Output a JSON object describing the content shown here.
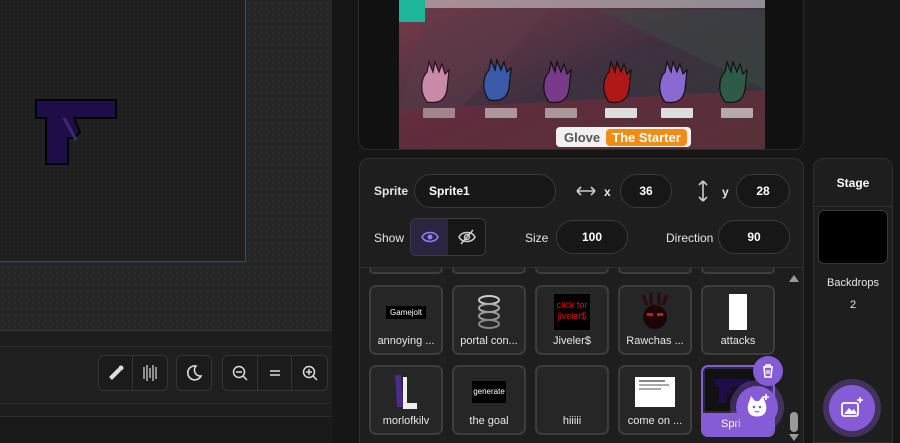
{
  "stage": {
    "monitor_label": "Glove",
    "monitor_value": "The Starter"
  },
  "sprite_info": {
    "sprite_label": "Sprite",
    "sprite_name": "Sprite1",
    "x_label": "x",
    "x_value": "36",
    "y_label": "y",
    "y_value": "28",
    "show_label": "Show",
    "size_label": "Size",
    "size_value": "100",
    "direction_label": "Direction",
    "direction_value": "90"
  },
  "sprites": {
    "row1": [
      {
        "name": "annoying ...",
        "thumb_text": "Gamejolt"
      },
      {
        "name": "portal con...",
        "thumb_text": ""
      },
      {
        "name": "Jiveler$",
        "thumb_text_1": "click for",
        "thumb_text_2": "jiveler$"
      },
      {
        "name": "Rawchas ...",
        "thumb_text": ""
      },
      {
        "name": "attacks",
        "thumb_text": ""
      }
    ],
    "row2": [
      {
        "name": "morlofkilv",
        "thumb_text": ""
      },
      {
        "name": "the goal",
        "thumb_text": "generate"
      },
      {
        "name": "hiiiii",
        "thumb_text": ""
      },
      {
        "name": "come on ...",
        "thumb_text": ""
      },
      {
        "name": "Spri",
        "thumb_text": ""
      }
    ]
  },
  "stage_panel": {
    "title": "Stage",
    "backdrops_label": "Backdrops",
    "backdrops_count": "2"
  },
  "colors": {
    "accent": "#855cd6",
    "monitor_value_bg": "#f38c15",
    "panel_bg": "#1e1e1e"
  }
}
